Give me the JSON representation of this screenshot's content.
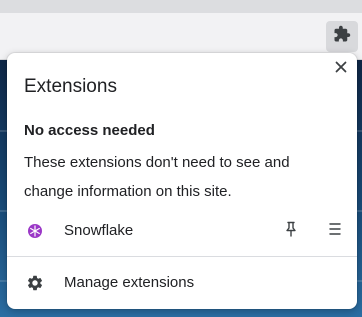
{
  "panel": {
    "title": "Extensions",
    "section_heading": "No access needed",
    "section_description": "These extensions don't need to see and change information on this site."
  },
  "extensions": [
    {
      "name": "Snowflake",
      "icon": "snowflake-icon",
      "icon_color": "#9b38c7"
    }
  ],
  "footer": {
    "manage_label": "Manage extensions",
    "manage_icon": "gear-icon"
  },
  "toolbar": {
    "extensions_button_icon": "puzzle-icon"
  },
  "colors": {
    "text": "#202124",
    "accent_purple": "#9b38c7"
  }
}
